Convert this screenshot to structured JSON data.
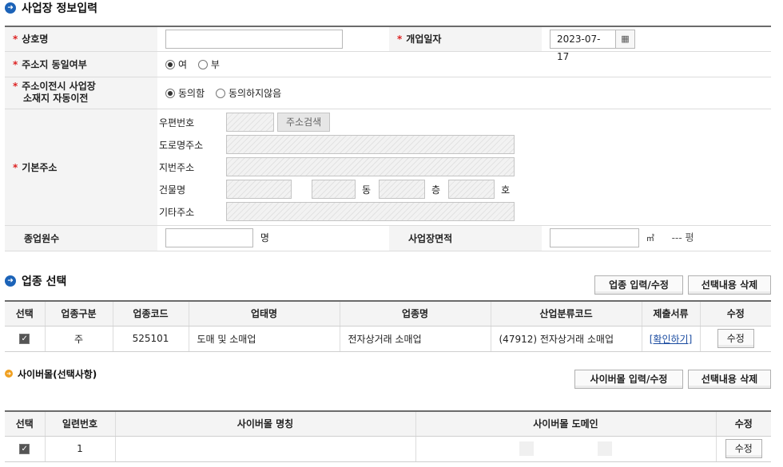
{
  "biz_section": {
    "title": "사업장 정보입력"
  },
  "form": {
    "required_mark": "*",
    "trade_name": {
      "label": "상호명",
      "value": ""
    },
    "open_date": {
      "label": "개업일자",
      "value": "2023-07-17"
    },
    "same_address": {
      "label": "주소지 동일여부",
      "options": [
        "여",
        "부"
      ],
      "selected": "여"
    },
    "auto_transfer": {
      "label_line1": "주소이전시 사업장",
      "label_line2": "소재지 자동이전",
      "options": [
        "동의함",
        "동의하지않음"
      ],
      "selected": "동의함"
    },
    "address": {
      "label": "기본주소",
      "zipcode_label": "우편번호",
      "search_button": "주소검색",
      "road_label": "도로명주소",
      "lot_label": "지번주소",
      "building_label": "건물명",
      "dong_unit": "동",
      "floor_unit": "층",
      "ho_unit": "호",
      "etc_label": "기타주소"
    },
    "employees": {
      "label": "종업원수",
      "unit": "명",
      "value": ""
    },
    "area": {
      "label": "사업장면적",
      "unit_m2": "㎡",
      "pyeong_value": "---",
      "unit_pyeong": "평",
      "value": ""
    }
  },
  "industry_section": {
    "title": "업종 선택",
    "edit_button": "업종 입력/수정",
    "delete_button": "선택내용 삭제",
    "columns": [
      "선택",
      "업종구분",
      "업종코드",
      "업태명",
      "업종명",
      "산업분류코드",
      "제출서류",
      "수정"
    ],
    "rows": [
      {
        "type": "주",
        "code": "525101",
        "business": "도매 및 소매업",
        "item": "전자상거래 소매업",
        "class_code": "(47912) 전자상거래 소매업",
        "docs": "[확인하기]",
        "edit": "수정"
      }
    ]
  },
  "mall_section": {
    "title": "사이버몰(선택사항)",
    "edit_button": "사이버몰 입력/수정",
    "delete_button": "선택내용 삭제",
    "columns": [
      "선택",
      "일련번호",
      "사이버몰 명칭",
      "사이버몰 도메인",
      "수정"
    ],
    "rows": [
      {
        "serial": "1",
        "name": "",
        "edit": "수정"
      }
    ]
  },
  "icons": {
    "section_bullet": "arrow-circle-icon",
    "sub_bullet": "arrow-circle-small-icon",
    "calendar": "calendar-icon",
    "checkbox": "checkbox-checked-icon"
  },
  "colors": {
    "section_bullet": "#1c63b8",
    "sub_bullet": "#f0a020",
    "required": "#dd2222",
    "link": "#1a4ba0"
  }
}
